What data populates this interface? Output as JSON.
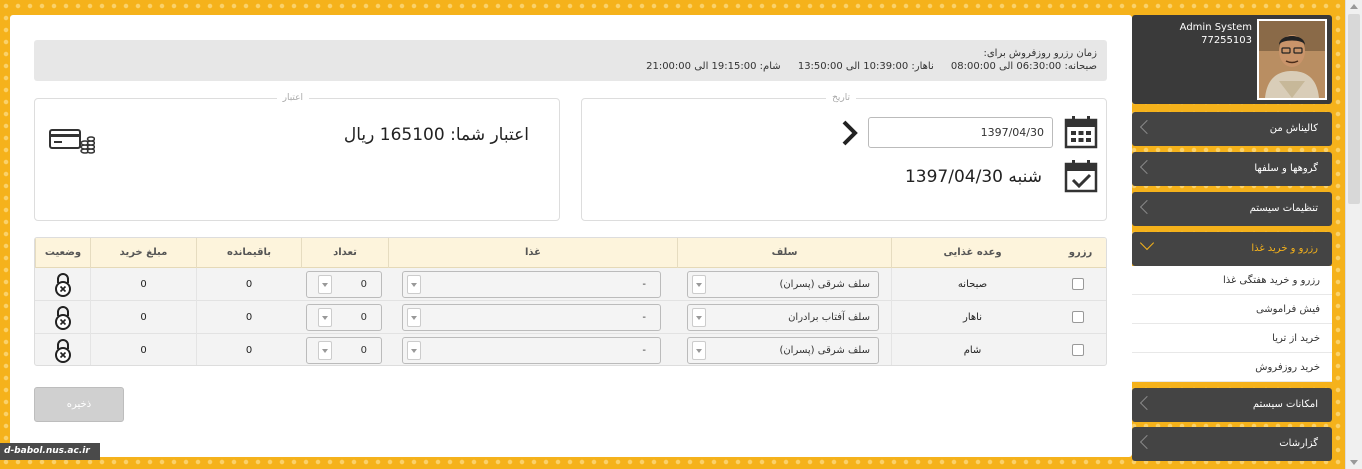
{
  "hours": {
    "title": "زمان رزرو روزفروش برای:",
    "items": [
      "صبحانه: 06:30:00 الی 08:00:00",
      "ناهار: 10:39:00 الی 13:50:00",
      "شام: 19:15:00 الی 21:00:00"
    ]
  },
  "date_panel": {
    "legend": "تاریخ",
    "input_value": "1397/04/30",
    "display": "شنبه 1397/04/30"
  },
  "credit_panel": {
    "legend": "اعتبار",
    "text": "اعتبار شما: 165100 ریال"
  },
  "table": {
    "headers": {
      "reserve": "رزرو",
      "meal": "وعده غذایی",
      "self": "سلف",
      "food": "غذا",
      "count": "تعداد",
      "remaining": "باقیمانده",
      "amount": "مبلغ خرید",
      "status": "وضعیت"
    },
    "rows": [
      {
        "meal": "صبحانه",
        "self": "سلف شرقی (پسران)",
        "food": "-",
        "count": "0",
        "remaining": "0",
        "amount": "0"
      },
      {
        "meal": "ناهار",
        "self": "سلف آفتاب برادران",
        "food": "-",
        "count": "0",
        "remaining": "0",
        "amount": "0"
      },
      {
        "meal": "شام",
        "self": "سلف شرقی (پسران)",
        "food": "-",
        "count": "0",
        "remaining": "0",
        "amount": "0"
      }
    ]
  },
  "save_label": "ذخیره",
  "user": {
    "name": "Admin System",
    "id": "77255103"
  },
  "menu": {
    "my_collection": "کالیناش من",
    "groups": "گروهها و سلفها",
    "system_settings": "تنظیمات سیستم",
    "reserve_food": "رزرو و خرید غذا",
    "sub": [
      "رزرو و خرید هفتگی غذا",
      "فیش فراموشی",
      "خرید از تریا",
      "خرید روزفروش"
    ],
    "system_features": "امکانات سیستم",
    "reports": "گزارشات"
  },
  "watermark": "d-babol.nus.ac.ir",
  "colors": {
    "accent": "#f5b21b",
    "sidebar": "#444444",
    "header_row": "#fdf4dc"
  }
}
